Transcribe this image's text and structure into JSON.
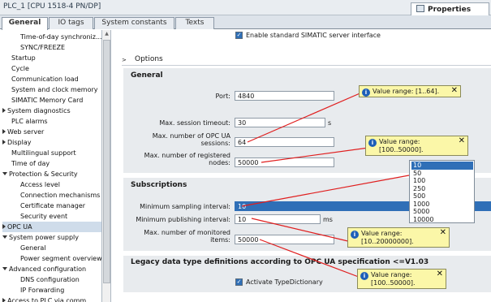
{
  "window": {
    "title": "PLC_1 [CPU 1518-4 PN/DP]",
    "properties_tab": "Properties"
  },
  "tabs": [
    "General",
    "IO tags",
    "System constants",
    "Texts"
  ],
  "nav": [
    {
      "label": "Time-of-day synchroniz...",
      "indent": 2
    },
    {
      "label": "SYNC/FREEZE",
      "indent": 2
    },
    {
      "label": "Startup",
      "indent": 1
    },
    {
      "label": "Cycle",
      "indent": 1
    },
    {
      "label": "Communication load",
      "indent": 1
    },
    {
      "label": "System and clock memory",
      "indent": 1
    },
    {
      "label": "SIMATIC Memory Card",
      "indent": 1
    },
    {
      "label": "System diagnostics",
      "indent": 0,
      "arrow": "right"
    },
    {
      "label": "PLC alarms",
      "indent": 1
    },
    {
      "label": "Web server",
      "indent": 0,
      "arrow": "right"
    },
    {
      "label": "Display",
      "indent": 0,
      "arrow": "right"
    },
    {
      "label": "Multilingual support",
      "indent": 1
    },
    {
      "label": "Time of day",
      "indent": 1
    },
    {
      "label": "Protection & Security",
      "indent": 0,
      "arrow": "down"
    },
    {
      "label": "Access level",
      "indent": 2
    },
    {
      "label": "Connection mechanisms",
      "indent": 2
    },
    {
      "label": "Certificate manager",
      "indent": 2
    },
    {
      "label": "Security event",
      "indent": 2
    },
    {
      "label": "OPC UA",
      "indent": 0,
      "arrow": "right",
      "selected": true
    },
    {
      "label": "System power supply",
      "indent": 0,
      "arrow": "down"
    },
    {
      "label": "General",
      "indent": 2
    },
    {
      "label": "Power segment overview",
      "indent": 2
    },
    {
      "label": "Advanced configuration",
      "indent": 0,
      "arrow": "down"
    },
    {
      "label": "DNS configuration",
      "indent": 2
    },
    {
      "label": "IP Forwarding",
      "indent": 2
    },
    {
      "label": "Access to PLC via comm...",
      "indent": 0,
      "arrow": "right"
    }
  ],
  "top_checkbox": {
    "label": "Enable standard SIMATIC server interface",
    "checked": true
  },
  "options_heading": "Options",
  "general": {
    "title": "General",
    "port": {
      "label": "Port:",
      "value": "4840"
    },
    "max_session_timeout": {
      "label": "Max. session timeout:",
      "value": "30",
      "unit": "s"
    },
    "max_sessions": {
      "label1": "Max. number of OPC UA",
      "label2": "sessions:",
      "value": "64"
    },
    "max_nodes": {
      "label1": "Max. number of registered",
      "label2": "nodes:",
      "value": "50000"
    }
  },
  "subscriptions": {
    "title": "Subscriptions",
    "min_sampling": {
      "label": "Minimum sampling interval:",
      "value": "10"
    },
    "min_publishing": {
      "label": "Minimum publishing interval:",
      "value": "10",
      "unit": "ms"
    },
    "max_monitored": {
      "label1": "Max. number of monitored",
      "label2": "items:",
      "value": "50000"
    }
  },
  "dropdown_options": [
    "10",
    "50",
    "100",
    "250",
    "500",
    "1000",
    "5000",
    "10000"
  ],
  "legacy": {
    "title": "Legacy data type definitions according to OPC UA specification <=V1.03",
    "checkbox_label": "Activate TypeDictionary",
    "checked": true
  },
  "tooltips": [
    {
      "line1": "Value range: [1..64].",
      "line2": ""
    },
    {
      "line1": "Value range:",
      "line2": "[100..50000]."
    },
    {
      "line1": "Value range:",
      "line2": "[10..20000000]."
    },
    {
      "line1": "Value range:",
      "line2": "[100..50000]."
    }
  ],
  "colors": {
    "accent": "#2f6fb7",
    "tooltip_bg": "#fbf7a8",
    "callout_line": "#e01e1e",
    "section_bg": "#e8ebee"
  }
}
